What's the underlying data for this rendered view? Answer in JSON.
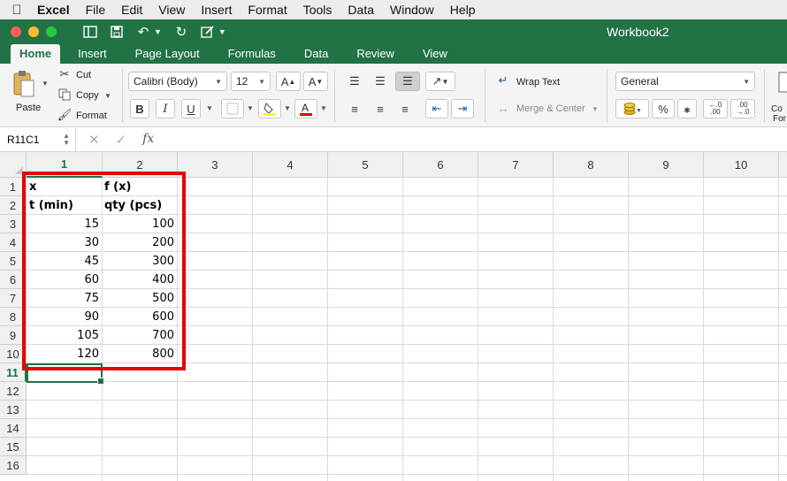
{
  "menubar": {
    "app": "Excel",
    "items": [
      "File",
      "Edit",
      "View",
      "Insert",
      "Format",
      "Tools",
      "Data",
      "Window",
      "Help"
    ]
  },
  "titlebar": {
    "title": "Workbook2"
  },
  "ribbon_tabs": [
    "Home",
    "Insert",
    "Page Layout",
    "Formulas",
    "Data",
    "Review",
    "View"
  ],
  "ribbon": {
    "paste": "Paste",
    "cut": "Cut",
    "copy": "Copy",
    "format": "Format",
    "font_name": "Calibri (Body)",
    "font_size": "12",
    "wrap_text": "Wrap Text",
    "merge_center": "Merge & Center",
    "number_format": "General",
    "conditional_partial": "Co",
    "conditional_partial2": "For"
  },
  "formula_bar": {
    "name_box": "R11C1",
    "formula": ""
  },
  "columns": [
    "1",
    "2",
    "3",
    "4",
    "5",
    "6",
    "7",
    "8",
    "9",
    "10"
  ],
  "rows": [
    "1",
    "2",
    "3",
    "4",
    "5",
    "6",
    "7",
    "8",
    "9",
    "10",
    "11",
    "12",
    "13",
    "14",
    "15",
    "16"
  ],
  "table": {
    "header1": [
      "x",
      "f (x)"
    ],
    "header2": [
      "t (min)",
      "qty (pcs)"
    ],
    "data": [
      [
        "15",
        "100"
      ],
      [
        "30",
        "200"
      ],
      [
        "45",
        "300"
      ],
      [
        "60",
        "400"
      ],
      [
        "75",
        "500"
      ],
      [
        "90",
        "600"
      ],
      [
        "105",
        "700"
      ],
      [
        "120",
        "800"
      ]
    ]
  },
  "colors": {
    "excel_green": "#217346",
    "highlight_red": "#e60000"
  }
}
